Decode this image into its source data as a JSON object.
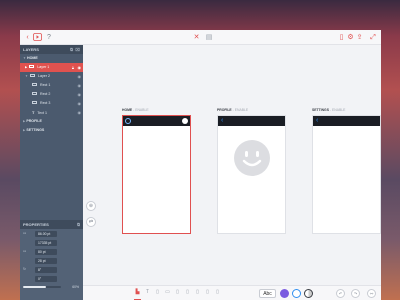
{
  "layers_panel": {
    "title": "LAYERS",
    "groups": [
      {
        "label": "HOME",
        "expanded": true
      },
      {
        "label": "PROFILE",
        "expanded": false
      },
      {
        "label": "SETTINGS",
        "expanded": false
      }
    ],
    "layers": [
      {
        "label": "Layer 1",
        "selected": true,
        "locked": true,
        "icon": "rectangle-icon"
      },
      {
        "label": "Layer 2",
        "selected": false,
        "icon": "folder-icon"
      },
      {
        "label": "Rect 1",
        "selected": false,
        "icon": "rectangle-icon"
      },
      {
        "label": "Rect 2",
        "selected": false,
        "icon": "rectangle-icon"
      },
      {
        "label": "Rect 3",
        "selected": false,
        "icon": "rectangle-icon"
      },
      {
        "label": "Text 1",
        "selected": false,
        "icon": "text-icon"
      }
    ]
  },
  "properties_panel": {
    "title": "PROPERTIES",
    "fields": [
      {
        "value": "86.00 pt"
      },
      {
        "value": "17335 pt"
      },
      {
        "value": "80 pt"
      },
      {
        "value": "28 pt"
      },
      {
        "value": "8°"
      },
      {
        "value": "0°"
      }
    ],
    "opacity_value": "60%",
    "opacity_level": 0.6
  },
  "screens": [
    {
      "name": "HOME",
      "sub": "- ENABLE",
      "selected": true
    },
    {
      "name": "PROFILE",
      "sub": "- ENABLE",
      "selected": false
    },
    {
      "name": "SETTINGS",
      "sub": "- ENABLE",
      "selected": false
    }
  ],
  "bottombar": {
    "text_style_label": "Abc",
    "colors": {
      "accent": "#e05050",
      "purple": "#7a5be0",
      "blue": "#2f8ef0"
    }
  },
  "colors": {
    "panel_bg": "#4b5a6e",
    "selection": "#e0524f",
    "canvas_bg": "#f2f3f6"
  }
}
